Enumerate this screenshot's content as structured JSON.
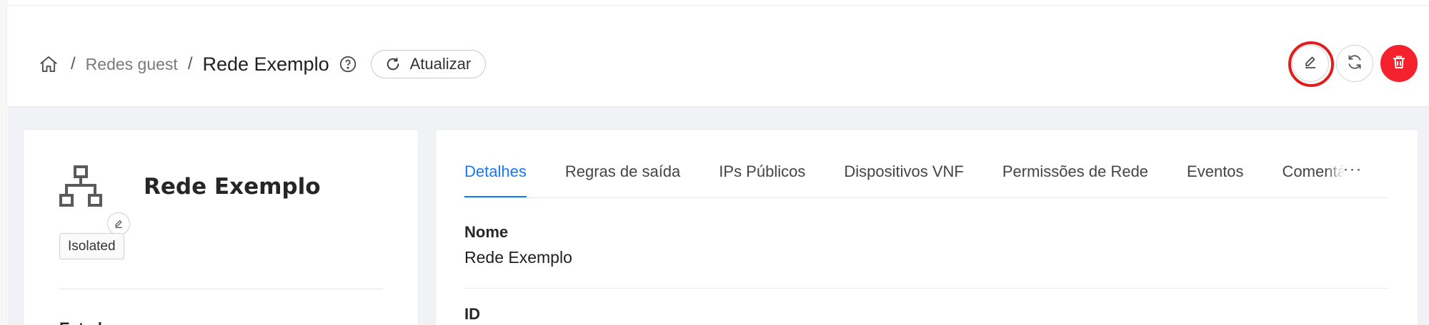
{
  "breadcrumb": {
    "home_icon": "home-icon",
    "separator": "/",
    "parent": "Redes guest",
    "current": "Rede Exemplo"
  },
  "toolbar": {
    "refresh_label": "Atualizar"
  },
  "actions": {
    "edit_icon": "edit-icon",
    "refresh_icon": "refresh-icon",
    "delete_icon": "trash-icon",
    "delete_color": "#f5222d",
    "highlight_color": "#e01e1e"
  },
  "resource": {
    "name": "Rede Exemplo",
    "icon": "network-icon",
    "type_tag": "Isolated",
    "next_section_label_partial": "Estado"
  },
  "tabs": [
    {
      "label": "Detalhes",
      "active": true
    },
    {
      "label": "Regras de saída",
      "active": false
    },
    {
      "label": "IPs Públicos",
      "active": false
    },
    {
      "label": "Dispositivos VNF",
      "active": false
    },
    {
      "label": "Permissões de Rede",
      "active": false
    },
    {
      "label": "Eventos",
      "active": false
    },
    {
      "label": "Comentários",
      "active": false
    }
  ],
  "tabs_more": "···",
  "details": {
    "name_label": "Nome",
    "name_value": "Rede Exemplo",
    "id_label": "ID"
  },
  "accent_color": "#1677ff"
}
